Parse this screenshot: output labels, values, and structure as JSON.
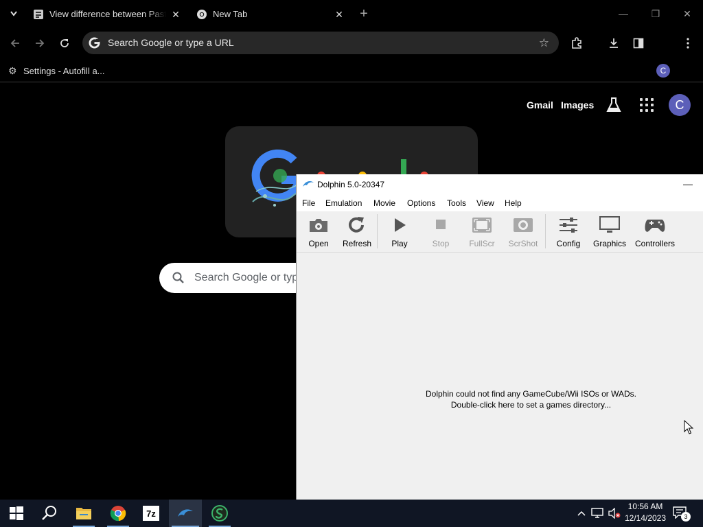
{
  "chrome": {
    "tabs": [
      {
        "title": "View difference between Paste",
        "active": false
      },
      {
        "title": "New Tab",
        "active": true
      }
    ],
    "new_tab_symbol": "+",
    "window_controls": {
      "minimize": "—",
      "restore": "❐",
      "close": "✕"
    },
    "omnibox": {
      "placeholder": "Search Google or type a URL"
    },
    "bookmarks": [
      {
        "label": "Settings - Autofill a..."
      }
    ],
    "profile_initial": "C",
    "ntp": {
      "links": {
        "gmail": "Gmail",
        "images": "Images"
      },
      "profile_initial": "C",
      "search_placeholder": "Search Google or type a URL"
    },
    "accent": "#5c5fb9"
  },
  "dolphin": {
    "title": "Dolphin 5.0-20347",
    "minimize": "—",
    "menu": [
      "File",
      "Emulation",
      "Movie",
      "Options",
      "Tools",
      "View",
      "Help"
    ],
    "toolbar": [
      {
        "label": "Open",
        "icon": "open-icon",
        "enabled": true
      },
      {
        "label": "Refresh",
        "icon": "refresh-icon",
        "enabled": true
      },
      {
        "label": "Play",
        "icon": "play-icon",
        "enabled": true
      },
      {
        "label": "Stop",
        "icon": "stop-icon",
        "enabled": false
      },
      {
        "label": "FullScr",
        "icon": "fullscreen-icon",
        "enabled": false
      },
      {
        "label": "ScrShot",
        "icon": "screenshot-icon",
        "enabled": false
      },
      {
        "label": "Config",
        "icon": "config-icon",
        "enabled": true
      },
      {
        "label": "Graphics",
        "icon": "graphics-icon",
        "enabled": true
      },
      {
        "label": "Controllers",
        "icon": "controllers-icon",
        "enabled": true
      }
    ],
    "empty_message": {
      "line1": "Dolphin could not find any GameCube/Wii ISOs or WADs.",
      "line2": "Double-click here to set a games directory..."
    }
  },
  "taskbar": {
    "items": [
      {
        "name": "start",
        "icon": "windows-icon"
      },
      {
        "name": "search",
        "icon": "search-icon"
      },
      {
        "name": "file-explorer",
        "icon": "folder-icon"
      },
      {
        "name": "chrome",
        "icon": "chrome-icon"
      },
      {
        "name": "7zip",
        "icon": "7zip-icon",
        "label": "7z"
      },
      {
        "name": "dolphin",
        "icon": "dolphin-icon",
        "active": true
      },
      {
        "name": "app",
        "icon": "green-app-icon"
      }
    ],
    "clock": {
      "time": "10:56 AM",
      "date": "12/14/2023"
    },
    "notification_count": "3"
  }
}
